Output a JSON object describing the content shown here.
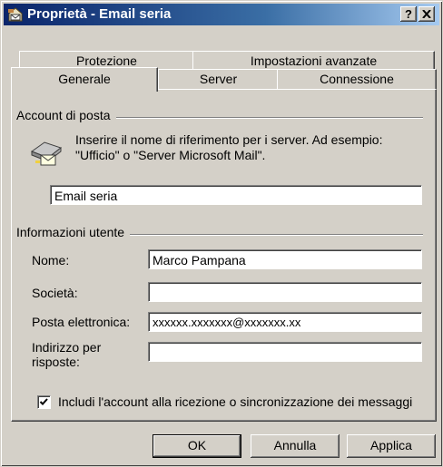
{
  "window": {
    "title": "Proprietà - Email seria",
    "help_button": "?",
    "close_button": "x"
  },
  "tabs": {
    "row1": [
      "Protezione",
      "Impostazioni avanzate"
    ],
    "row2": [
      "Generale",
      "Server",
      "Connessione"
    ],
    "active": "Generale"
  },
  "account": {
    "group_label": "Account di posta",
    "description": "Inserire il nome di riferimento per i server. Ad esempio: \"Ufficio\" o \"Server Microsoft Mail\".",
    "name_value": "Email seria",
    "icon": "mail-account-icon"
  },
  "user_info": {
    "group_label": "Informazioni utente",
    "name_label": "Nome:",
    "name_value": "Marco Pampana",
    "company_label": "Società:",
    "company_value": "",
    "email_label": "Posta elettronica:",
    "email_value": "xxxxxx.xxxxxxx@xxxxxxx.xx",
    "reply_label_line1": "Indirizzo per",
    "reply_label_line2": "risposte:",
    "reply_value": ""
  },
  "include_checkbox": {
    "label": "Includi l'account alla ricezione o sincronizzazione dei messaggi",
    "checked": true
  },
  "buttons": {
    "ok": "OK",
    "cancel": "Annulla",
    "apply": "Applica"
  }
}
